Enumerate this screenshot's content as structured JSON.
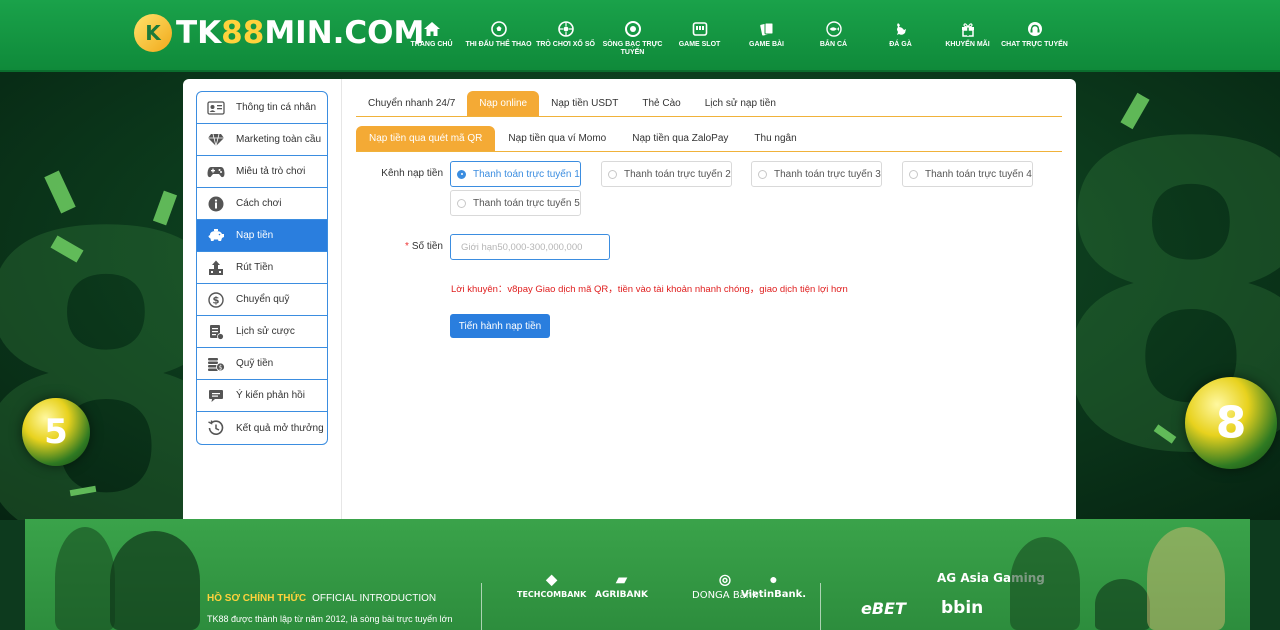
{
  "header": {
    "logo_mark": "K",
    "logo_prefix": "TK",
    "logo_highlight": "88",
    "logo_suffix": "MIN.COM",
    "nav": [
      {
        "label": "TRANG CHỦ",
        "icon": "home-icon"
      },
      {
        "label": "THI ĐẤU THỂ THAO",
        "icon": "soccer-icon"
      },
      {
        "label": "TRÒ CHƠI XỔ SỐ",
        "icon": "lottery-icon"
      },
      {
        "label": "SÒNG BẠC TRỰC TUYẾN",
        "icon": "casino-chip-icon"
      },
      {
        "label": "GAME SLOT",
        "icon": "slot-machine-icon"
      },
      {
        "label": "GAME BÀI",
        "icon": "cards-icon"
      },
      {
        "label": "BẮN CÁ",
        "icon": "fish-icon"
      },
      {
        "label": "ĐÁ GÀ",
        "icon": "rooster-icon"
      },
      {
        "label": "KHUYẾN MÃI",
        "icon": "gift-icon"
      },
      {
        "label": "CHAT TRỰC TUYẾN",
        "icon": "headset-icon"
      }
    ]
  },
  "sidebar": {
    "items": [
      {
        "label": "Thông tin cá nhân",
        "icon": "id-card-icon"
      },
      {
        "label": "Marketing toàn cầu",
        "icon": "diamond-icon"
      },
      {
        "label": "Miêu tả trò chơi",
        "icon": "gamepad-icon"
      },
      {
        "label": "Cách chơi",
        "icon": "info-icon"
      },
      {
        "label": "Nạp tiền",
        "icon": "piggy-bank-icon",
        "active": true
      },
      {
        "label": "Rút Tiền",
        "icon": "withdraw-icon"
      },
      {
        "label": "Chuyển quỹ",
        "icon": "dollar-circle-icon"
      },
      {
        "label": "Lịch sử cược",
        "icon": "history-doc-icon"
      },
      {
        "label": "Quỹ tiền",
        "icon": "coins-icon"
      },
      {
        "label": "Ý kiến phản hồi",
        "icon": "chat-bubble-icon"
      },
      {
        "label": "Kết quả mở thưởng",
        "icon": "clock-history-icon"
      }
    ]
  },
  "tabs_primary": [
    {
      "label": "Chuyển nhanh 24/7"
    },
    {
      "label": "Nạp online",
      "active": true
    },
    {
      "label": "Nạp tiền USDT"
    },
    {
      "label": "Thẻ Cào"
    },
    {
      "label": "Lịch sử nạp tiền"
    }
  ],
  "tabs_secondary": [
    {
      "label": "Nạp tiền qua quét mã QR",
      "active": true
    },
    {
      "label": "Nạp tiền qua ví Momo"
    },
    {
      "label": "Nạp tiền qua ZaloPay"
    },
    {
      "label": "Thu ngân"
    }
  ],
  "form": {
    "channel_label": "Kênh nạp tiền",
    "channels": [
      {
        "label": "Thanh toán trực tuyến 1",
        "selected": true
      },
      {
        "label": "Thanh toán trực tuyến 2"
      },
      {
        "label": "Thanh toán trực tuyến 3"
      },
      {
        "label": "Thanh toán trực tuyến 4"
      },
      {
        "label": "Thanh toán trực tuyến 5"
      }
    ],
    "amount_required_mark": "*",
    "amount_label": "Số tiền",
    "amount_placeholder": "Giới hạn50,000-300,000,000",
    "amount_value": "",
    "advice": "Lời khuyên：v8pay Giao dịch mã QR，tiền vào tài khoản nhanh chóng，giao dịch tiện lợi hơn",
    "submit_label": "Tiến hành nạp tiền"
  },
  "footer": {
    "title_highlight": "HỒ SƠ CHÍNH THỨC",
    "title_rest": "OFFICIAL INTRODUCTION",
    "description": "TK88 được thành lập từ năm 2012, là sòng bài trực tuyến lớn",
    "banks": [
      "TECHCOMBANK",
      "AGRIBANK",
      "DONGA Bank",
      "VietinBank."
    ],
    "partners": [
      "AG Asia Gaming",
      "eBET",
      "bbin"
    ]
  },
  "colors": {
    "brand_green": "#1aa24a",
    "accent_orange": "#f4aa35",
    "primary_blue": "#2a7ede",
    "advice_red": "#e02020",
    "logo_yellow": "#ffd23c"
  }
}
